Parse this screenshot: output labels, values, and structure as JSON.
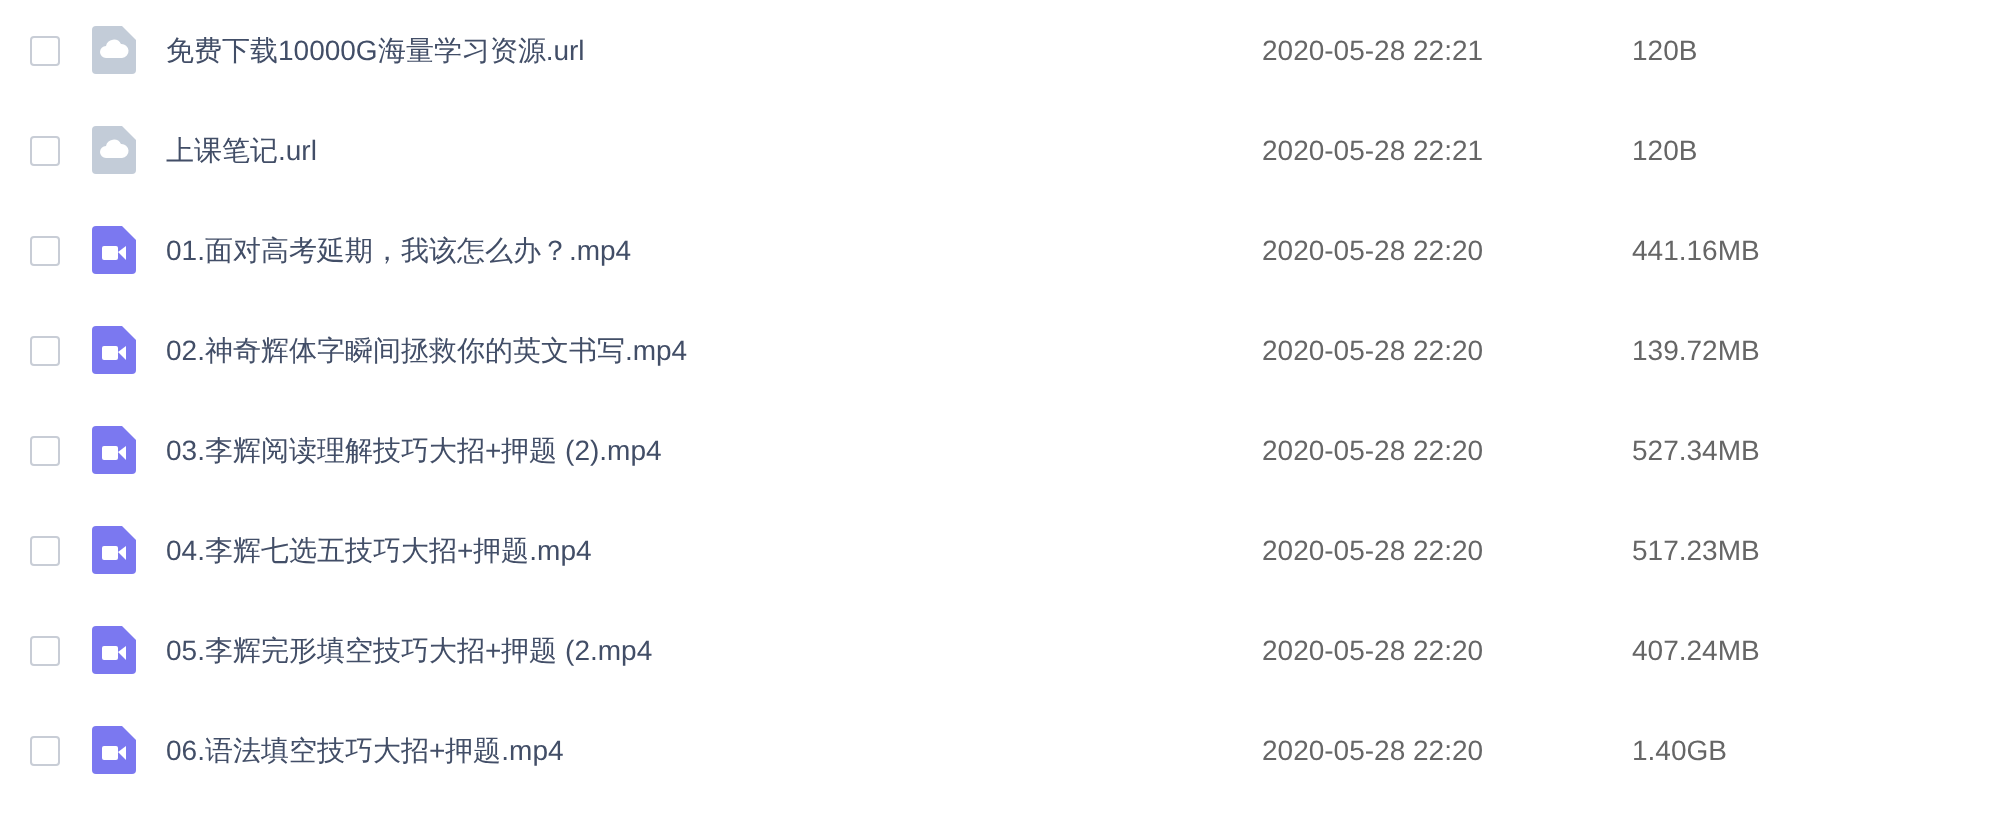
{
  "files": [
    {
      "kind": "link",
      "checked": false,
      "name": "免费下载10000G海量学习资源.url",
      "modified": "2020-05-28 22:21",
      "size": "120B"
    },
    {
      "kind": "link",
      "checked": false,
      "name": "上课笔记.url",
      "modified": "2020-05-28 22:21",
      "size": "120B"
    },
    {
      "kind": "video",
      "checked": false,
      "name": "01.面对高考延期，我该怎么办？.mp4",
      "modified": "2020-05-28 22:20",
      "size": "441.16MB"
    },
    {
      "kind": "video",
      "checked": false,
      "name": "02.神奇辉体字瞬间拯救你的英文书写.mp4",
      "modified": "2020-05-28 22:20",
      "size": "139.72MB"
    },
    {
      "kind": "video",
      "checked": false,
      "name": "03.李辉阅读理解技巧大招+押题 (2).mp4",
      "modified": "2020-05-28 22:20",
      "size": "527.34MB"
    },
    {
      "kind": "video",
      "checked": false,
      "name": "04.李辉七选五技巧大招+押题.mp4",
      "modified": "2020-05-28 22:20",
      "size": "517.23MB"
    },
    {
      "kind": "video",
      "checked": false,
      "name": "05.李辉完形填空技巧大招+押题 (2.mp4",
      "modified": "2020-05-28 22:20",
      "size": "407.24MB"
    },
    {
      "kind": "video",
      "checked": false,
      "name": "06.语法填空技巧大招+押题.mp4",
      "modified": "2020-05-28 22:20",
      "size": "1.40GB"
    }
  ]
}
